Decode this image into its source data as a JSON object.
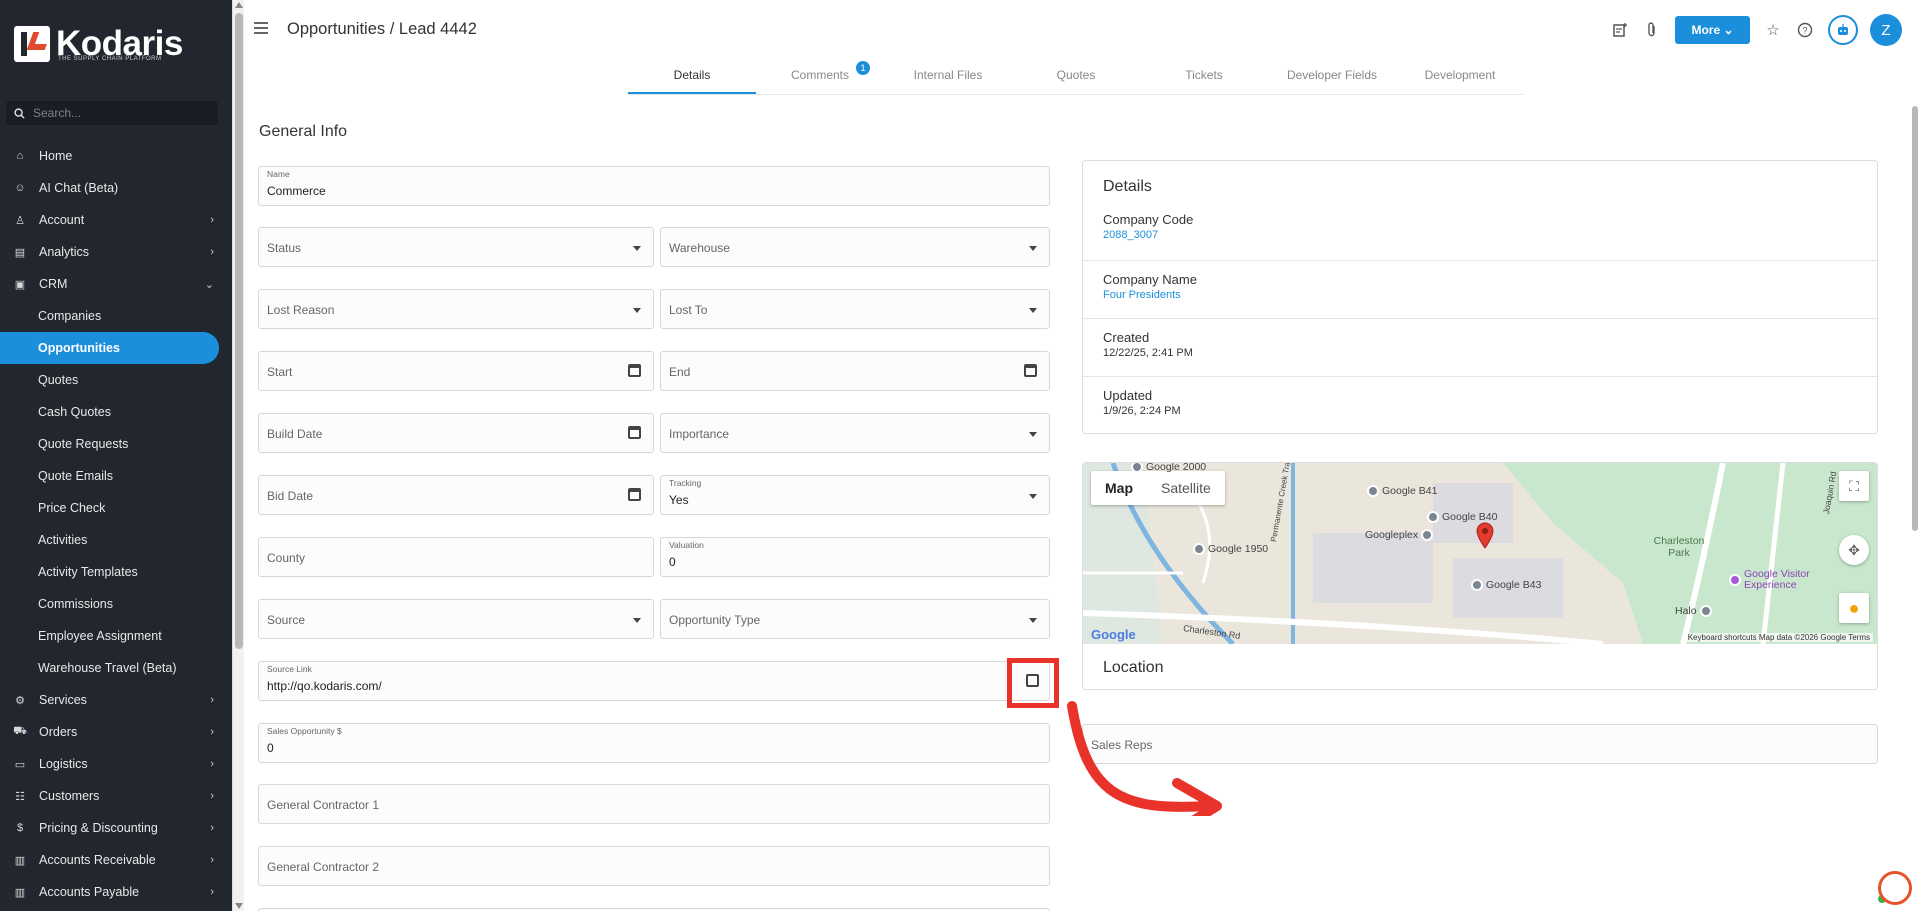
{
  "app": {
    "brand": "Kodaris",
    "tagline": "THE SUPPLY CHAIN PLATFORM"
  },
  "sidebar": {
    "search_placeholder": "Search...",
    "items": [
      {
        "label": "Home",
        "icon": "home-icon",
        "chevron": false,
        "sub": false,
        "active": false
      },
      {
        "label": "AI Chat (Beta)",
        "icon": "robot-icon",
        "chevron": false,
        "sub": false,
        "active": false
      },
      {
        "label": "Account",
        "icon": "user-icon",
        "chevron": true,
        "sub": false,
        "active": false
      },
      {
        "label": "Analytics",
        "icon": "chart-icon",
        "chevron": true,
        "sub": false,
        "active": false
      },
      {
        "label": "CRM",
        "icon": "crm-icon",
        "chevron": true,
        "sub": false,
        "active": false,
        "expanded": true
      },
      {
        "label": "Companies",
        "sub": true,
        "active": false
      },
      {
        "label": "Opportunities",
        "sub": true,
        "active": true
      },
      {
        "label": "Quotes",
        "sub": true,
        "active": false
      },
      {
        "label": "Cash Quotes",
        "sub": true,
        "active": false
      },
      {
        "label": "Quote Requests",
        "sub": true,
        "active": false
      },
      {
        "label": "Quote Emails",
        "sub": true,
        "active": false
      },
      {
        "label": "Price Check",
        "sub": true,
        "active": false
      },
      {
        "label": "Activities",
        "sub": true,
        "active": false
      },
      {
        "label": "Activity Templates",
        "sub": true,
        "active": false
      },
      {
        "label": "Commissions",
        "sub": true,
        "active": false
      },
      {
        "label": "Employee Assignment",
        "sub": true,
        "active": false
      },
      {
        "label": "Warehouse Travel (Beta)",
        "sub": true,
        "active": false
      },
      {
        "label": "Services",
        "icon": "services-icon",
        "chevron": true,
        "sub": false,
        "active": false
      },
      {
        "label": "Orders",
        "icon": "truck-icon",
        "chevron": true,
        "sub": false,
        "active": false
      },
      {
        "label": "Logistics",
        "icon": "logistics-icon",
        "chevron": true,
        "sub": false,
        "active": false
      },
      {
        "label": "Customers",
        "icon": "customers-icon",
        "chevron": true,
        "sub": false,
        "active": false
      },
      {
        "label": "Pricing & Discounting",
        "icon": "dollar-icon",
        "chevron": true,
        "sub": false,
        "active": false
      },
      {
        "label": "Accounts Receivable",
        "icon": "bank-icon",
        "chevron": true,
        "sub": false,
        "active": false
      },
      {
        "label": "Accounts Payable",
        "icon": "bank-icon",
        "chevron": true,
        "sub": false,
        "active": false
      }
    ]
  },
  "header": {
    "title": "Opportunities / Lead 4442",
    "more_label": "More",
    "avatar_initial": "Z"
  },
  "tabs": [
    {
      "label": "Details",
      "active": true,
      "badge": ""
    },
    {
      "label": "Comments",
      "active": false,
      "badge": "1"
    },
    {
      "label": "Internal Files",
      "active": false,
      "badge": ""
    },
    {
      "label": "Quotes",
      "active": false,
      "badge": ""
    },
    {
      "label": "Tickets",
      "active": false,
      "badge": ""
    },
    {
      "label": "Developer Fields",
      "active": false,
      "badge": ""
    },
    {
      "label": "Development",
      "active": false,
      "badge": ""
    }
  ],
  "general": {
    "title": "General Info",
    "name_label": "Name",
    "name_value": "Commerce",
    "status": "Status",
    "warehouse": "Warehouse",
    "lost_reason": "Lost Reason",
    "lost_to": "Lost To",
    "start": "Start",
    "end": "End",
    "build_date": "Build Date",
    "importance": "Importance",
    "bid_date": "Bid Date",
    "tracking_label": "Tracking",
    "tracking_value": "Yes",
    "county": "County",
    "valuation_label": "Valuation",
    "valuation_value": "0",
    "source": "Source",
    "opportunity_type": "Opportunity Type",
    "source_link_label": "Source Link",
    "source_link_value": "http://qo.kodaris.com/",
    "sales_opp_label": "Sales Opportunity $",
    "sales_opp_value": "0",
    "gc1": "General Contractor 1",
    "gc2": "General Contractor 2"
  },
  "details": {
    "title": "Details",
    "company_code_label": "Company Code",
    "company_code_value": "2088_3007",
    "company_name_label": "Company Name",
    "company_name_value": "Four Presidents",
    "created_label": "Created",
    "created_value": "12/22/25, 2:41 PM",
    "updated_label": "Updated",
    "updated_value": "1/9/26, 2:24 PM"
  },
  "map": {
    "tab_map": "Map",
    "tab_satellite": "Satellite",
    "pois": [
      "Google 2000",
      "Google B41",
      "Google B40",
      "Googleplex",
      "Google 1950",
      "Google B43",
      "Charleston Park",
      "Google Visitor Experience",
      "Halo",
      "Permanente Creek Trail",
      "Joaquin Rd",
      "Charleston Rd"
    ],
    "footer": "Keyboard shortcuts   Map data ©2026 Google   Terms",
    "google": "Google",
    "location_title": "Location"
  },
  "sales_reps": "Sales Reps",
  "colors": {
    "accent": "#1b8fdc",
    "sidebar_bg": "#22262e",
    "annotation": "#e8322a"
  }
}
